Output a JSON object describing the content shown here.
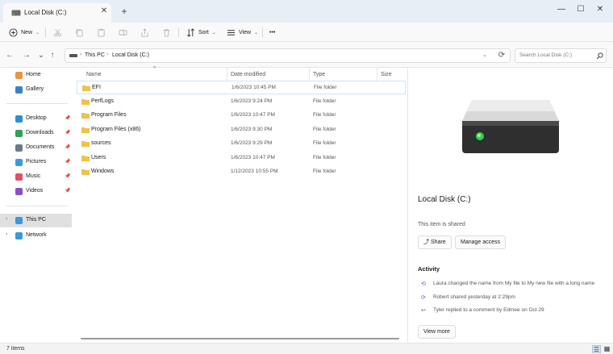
{
  "window": {
    "tab_title": "Local Disk (C:)",
    "new_tab": "+",
    "close_tab": "✕",
    "minimize": "—",
    "maximize": "☐",
    "close": "✕"
  },
  "toolbar": {
    "new_label": "New",
    "sort_label": "Sort",
    "view_label": "View",
    "more": "•••"
  },
  "address": {
    "crumbs": [
      "This PC",
      "Local Disk (C:)"
    ],
    "search_placeholder": "Search Local Disk (C:)"
  },
  "sidebar": {
    "top": [
      {
        "label": "Home",
        "icon": "home-icon",
        "color": "#e8973b"
      },
      {
        "label": "Gallery",
        "icon": "gallery-icon",
        "color": "#3b82c4"
      }
    ],
    "pinned": [
      {
        "label": "Desktop",
        "icon": "desktop-icon",
        "color": "#2c8fd6"
      },
      {
        "label": "Downloads",
        "icon": "downloads-icon",
        "color": "#2f9f5a"
      },
      {
        "label": "Documents",
        "icon": "documents-icon",
        "color": "#6a7a8c"
      },
      {
        "label": "Pictures",
        "icon": "pictures-icon",
        "color": "#3a9ad9"
      },
      {
        "label": "Music",
        "icon": "music-icon",
        "color": "#e0506a"
      },
      {
        "label": "Videos",
        "icon": "videos-icon",
        "color": "#8c4fc4"
      }
    ],
    "bottom": [
      {
        "label": "This PC",
        "icon": "this-pc-icon",
        "color": "#3a9ad9"
      },
      {
        "label": "Network",
        "icon": "network-icon",
        "color": "#3a9ad9"
      }
    ]
  },
  "columns": {
    "name": "Name",
    "date": "Date modified",
    "type": "Type",
    "size": "Size"
  },
  "files": [
    {
      "name": "EFI",
      "date": "1/6/2023 10:45 PM",
      "type": "File folder"
    },
    {
      "name": "PerfLogs",
      "date": "1/6/2023 9:24 PM",
      "type": "File folder"
    },
    {
      "name": "Program Files",
      "date": "1/6/2023 10:47 PM",
      "type": "File folder"
    },
    {
      "name": "Program Files (x86)",
      "date": "1/6/2023 9:30 PM",
      "type": "File folder"
    },
    {
      "name": "sources",
      "date": "1/6/2023 9:29 PM",
      "type": "File folder"
    },
    {
      "name": "Users",
      "date": "1/6/2023 10:47 PM",
      "type": "File folder"
    },
    {
      "name": "Windows",
      "date": "1/12/2023 10:55 PM",
      "type": "File folder"
    }
  ],
  "details": {
    "title": "Local Disk (C:)",
    "shared_text": "This item is shared",
    "share_label": "Share",
    "manage_label": "Manage access",
    "activity_heading": "Activity",
    "activity": [
      {
        "icon": "rename-icon",
        "text": "Laura changed the name from My file to My new file with a long name"
      },
      {
        "icon": "share-icon",
        "text": "Robert shared yesterday at 2:29pm"
      },
      {
        "icon": "reply-icon",
        "text": "Tyler replied to a comment by Edmee on Oct 29"
      }
    ],
    "view_more": "View more"
  },
  "status": {
    "item_count": "7 items"
  },
  "colors": {
    "folder": "#f0c14b",
    "accent": "#0067c0",
    "selected_border": "#cfe3f5",
    "drive_led": "#35d14a"
  }
}
